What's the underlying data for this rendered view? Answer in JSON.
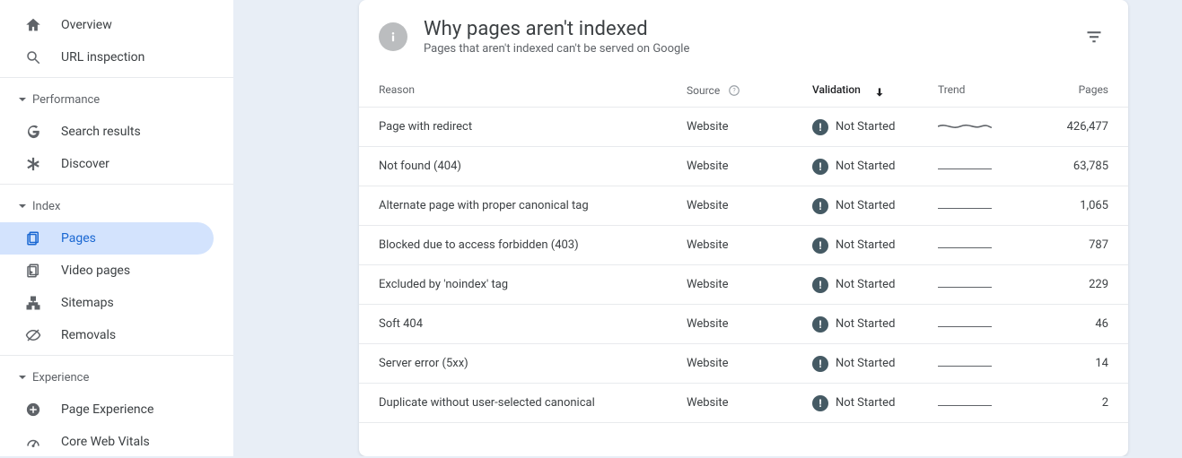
{
  "sidebar": {
    "overview": "Overview",
    "url_inspection": "URL inspection",
    "section_performance": "Performance",
    "search_results": "Search results",
    "discover": "Discover",
    "section_index": "Index",
    "pages": "Pages",
    "video_pages": "Video pages",
    "sitemaps": "Sitemaps",
    "removals": "Removals",
    "section_experience": "Experience",
    "page_experience": "Page Experience",
    "core_web_vitals": "Core Web Vitals"
  },
  "card": {
    "title": "Why pages aren't indexed",
    "subtitle": "Pages that aren't indexed can't be served on Google"
  },
  "columns": {
    "reason": "Reason",
    "source": "Source",
    "validation": "Validation",
    "trend": "Trend",
    "pages": "Pages"
  },
  "rows": [
    {
      "reason": "Page with redirect",
      "source": "Website",
      "validation": "Not Started",
      "pages": "426,477",
      "trend": "wave"
    },
    {
      "reason": "Not found (404)",
      "source": "Website",
      "validation": "Not Started",
      "pages": "63,785",
      "trend": "flat"
    },
    {
      "reason": "Alternate page with proper canonical tag",
      "source": "Website",
      "validation": "Not Started",
      "pages": "1,065",
      "trend": "flat"
    },
    {
      "reason": "Blocked due to access forbidden (403)",
      "source": "Website",
      "validation": "Not Started",
      "pages": "787",
      "trend": "flat"
    },
    {
      "reason": "Excluded by 'noindex' tag",
      "source": "Website",
      "validation": "Not Started",
      "pages": "229",
      "trend": "flat"
    },
    {
      "reason": "Soft 404",
      "source": "Website",
      "validation": "Not Started",
      "pages": "46",
      "trend": "flat"
    },
    {
      "reason": "Server error (5xx)",
      "source": "Website",
      "validation": "Not Started",
      "pages": "14",
      "trend": "flat"
    },
    {
      "reason": "Duplicate without user-selected canonical",
      "source": "Website",
      "validation": "Not Started",
      "pages": "2",
      "trend": "flat"
    }
  ]
}
